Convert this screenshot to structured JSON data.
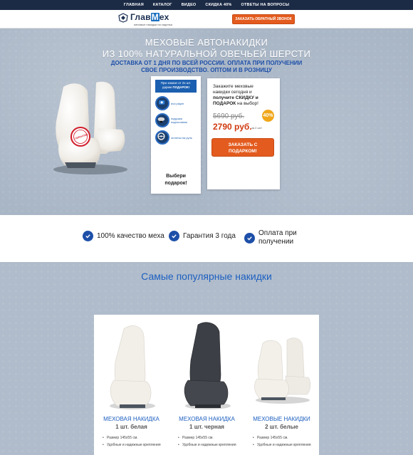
{
  "nav": {
    "items": [
      "ГЛАВНАЯ",
      "КАТАЛОГ",
      "ВИДЕО",
      "СКИДКА 40%",
      "ОТВЕТЫ НА ВОПРОСЫ"
    ]
  },
  "header": {
    "logo_text_a": "Глав",
    "logo_text_m": "М",
    "logo_text_b": "ех",
    "logo_tagline": "меховые накидки на сиденья",
    "callback_button": "ЗАКАЗАТЬ ОБРАТНЫЙ ЗВОНОК"
  },
  "hero": {
    "title_line1": "МЕХОВЫЕ АВТОНАКИДКИ",
    "title_line2": "ИЗ 100% НАТУРАЛЬНОЙ ОВЕЧЬЕЙ ШЕРСТИ",
    "subtitle_line1": "ДОСТАВКА ОТ 1 ДНЯ ПО ВСЕЙ РОССИИ. ОПЛАТА ПРИ ПОЛУЧЕНИИ",
    "subtitle_line2": "СВОЕ ПРОИЗВОДСТВО. ОПТОМ И В РОЗНИЦУ",
    "stamp_text": "ГАРАНТИЯ"
  },
  "gift": {
    "head_line1": "При заказе от 2х шт.",
    "head_line2_prefix": "дарим ",
    "head_line2_bold": "ПОДАРОК!",
    "items": [
      "dvd player",
      "подушка подголовник",
      "оплетка на руль"
    ],
    "choose_line1": "Выбери",
    "choose_line2": "подарок!"
  },
  "order": {
    "text_line1": "Закажите меховые",
    "text_line2": "накидки сегодня и",
    "text_bold1": "получите СКИДКУ и",
    "text_bold2": "ПОДАРОК",
    "text_tail": " на выбор!",
    "old_price": "5690 руб.",
    "new_price": "2790 руб.",
    "price_note": "за 2 шт.!",
    "discount": "40%",
    "button_line1": "ЗАКАЗАТЬ С",
    "button_line2": "ПОДАРКОМ!"
  },
  "features": [
    {
      "label_line1": "100% качество меха",
      "label_line2": ""
    },
    {
      "label_line1": "Гарантия 3 года",
      "label_line2": ""
    },
    {
      "label_line1": "Оплата при",
      "label_line2": "получении"
    }
  ],
  "popular": {
    "title": "Самые популярные накидки",
    "products": [
      {
        "name": "МЕХОВАЯ НАКИДКА",
        "sub": "1 шт. белая",
        "specs": [
          "Размер 145х55 см.",
          "Удобные и надежные крепления"
        ]
      },
      {
        "name": "МЕХОВАЯ НАКИДКА",
        "sub": "1 шт. черная",
        "specs": [
          "Размер 145х55 см.",
          "Удобные и надежные крепления"
        ]
      },
      {
        "name": "МЕХОВЫЕ НАКИДКИ",
        "sub": "2 шт. белые",
        "specs": [
          "Размер 145х55 см.",
          "Удобные и надежные крепления"
        ]
      }
    ]
  },
  "colors": {
    "accent": "#1d4fa8",
    "cta": "#e35b1e",
    "nav_bg": "#1b2a45",
    "hero_bg": "#a9b6c6"
  }
}
